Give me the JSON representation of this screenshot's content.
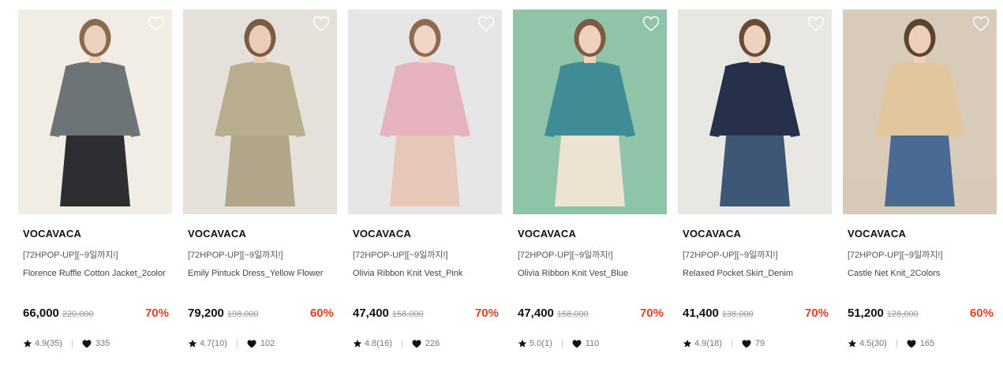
{
  "products": [
    {
      "brand": "VOCAVACA",
      "promo": "[72HPOP-UP][~9일까지!]",
      "name": "Florence Ruffle Cotton Jacket_2color",
      "price": "66,000",
      "original_price": "220,000",
      "discount": "70%",
      "rating": "4.9(35)",
      "likes": "335",
      "colors": {
        "bg": "#f1ece4",
        "top": "#6c7478",
        "bottom": "#2c2e31",
        "skin": "#ecd1bf",
        "hair": "#8a6a4c"
      }
    },
    {
      "brand": "VOCAVACA",
      "promo": "[72HPOP-UP][~9일까지!]",
      "name": "Emily Pintuck Dress_Yellow Flower",
      "price": "79,200",
      "original_price": "198,000",
      "discount": "60%",
      "rating": "4.7(10)",
      "likes": "102",
      "colors": {
        "bg": "#e5e1da",
        "top": "#b9ad90",
        "bottom": "#b1a58a",
        "skin": "#e9cdb9",
        "hair": "#7a5c42"
      }
    },
    {
      "brand": "VOCAVACA",
      "promo": "[72HPOP-UP][~9일까지!]",
      "name": "Olivia Ribbon Knit Vest_Pink",
      "price": "47,400",
      "original_price": "158,000",
      "discount": "70%",
      "rating": "4.8(16)",
      "likes": "226",
      "colors": {
        "bg": "#e7e6e6",
        "top": "#e8b3c0",
        "bottom": "#e7c8b8",
        "skin": "#efd6c6",
        "hair": "#8f6a4d"
      }
    },
    {
      "brand": "VOCAVACA",
      "promo": "[72HPOP-UP][~9일까지!]",
      "name": "Olivia Ribbon Knit Vest_Blue",
      "price": "47,400",
      "original_price": "158,000",
      "discount": "70%",
      "rating": "5.0(1)",
      "likes": "110",
      "colors": {
        "bg": "#8fc4a8",
        "top": "#3f8c96",
        "bottom": "#ece3d3",
        "skin": "#eed2bf",
        "hair": "#7c5b42"
      }
    },
    {
      "brand": "VOCAVACA",
      "promo": "[72HPOP-UP][~9일까지!]",
      "name": "Relaxed Pocket Skirt_Denim",
      "price": "41,400",
      "original_price": "138,000",
      "discount": "70%",
      "rating": "4.9(18)",
      "likes": "79",
      "colors": {
        "bg": "#e9e7e2",
        "top": "#26304a",
        "bottom": "#3f5777",
        "skin": "#ecd2c0",
        "hair": "#6a4a34"
      }
    },
    {
      "brand": "VOCAVACA",
      "promo": "[72HPOP-UP][~9일까지!]",
      "name": "Castle Net Knit_2Colors",
      "price": "51,200",
      "original_price": "128,000",
      "discount": "60%",
      "rating": "4.5(30)",
      "likes": "165",
      "colors": {
        "bg": "#d8cbb9",
        "top": "#e1c59c",
        "bottom": "#4a6a93",
        "skin": "#ecd0bc",
        "hair": "#5e4230"
      }
    }
  ],
  "icons": {
    "wishlist": "heart-outline-icon",
    "rating": "star-icon",
    "likes": "heart-filled-icon"
  },
  "theme": {
    "discount_color": "#e3401d"
  }
}
